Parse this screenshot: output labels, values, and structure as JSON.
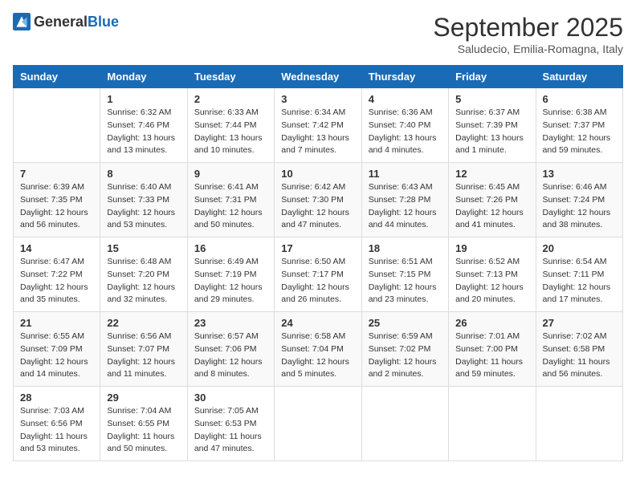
{
  "header": {
    "logo_general": "General",
    "logo_blue": "Blue",
    "month_title": "September 2025",
    "location": "Saludecio, Emilia-Romagna, Italy"
  },
  "days_of_week": [
    "Sunday",
    "Monday",
    "Tuesday",
    "Wednesday",
    "Thursday",
    "Friday",
    "Saturday"
  ],
  "weeks": [
    [
      {
        "day": "",
        "info": ""
      },
      {
        "day": "1",
        "info": "Sunrise: 6:32 AM\nSunset: 7:46 PM\nDaylight: 13 hours\nand 13 minutes."
      },
      {
        "day": "2",
        "info": "Sunrise: 6:33 AM\nSunset: 7:44 PM\nDaylight: 13 hours\nand 10 minutes."
      },
      {
        "day": "3",
        "info": "Sunrise: 6:34 AM\nSunset: 7:42 PM\nDaylight: 13 hours\nand 7 minutes."
      },
      {
        "day": "4",
        "info": "Sunrise: 6:36 AM\nSunset: 7:40 PM\nDaylight: 13 hours\nand 4 minutes."
      },
      {
        "day": "5",
        "info": "Sunrise: 6:37 AM\nSunset: 7:39 PM\nDaylight: 13 hours\nand 1 minute."
      },
      {
        "day": "6",
        "info": "Sunrise: 6:38 AM\nSunset: 7:37 PM\nDaylight: 12 hours\nand 59 minutes."
      }
    ],
    [
      {
        "day": "7",
        "info": "Sunrise: 6:39 AM\nSunset: 7:35 PM\nDaylight: 12 hours\nand 56 minutes."
      },
      {
        "day": "8",
        "info": "Sunrise: 6:40 AM\nSunset: 7:33 PM\nDaylight: 12 hours\nand 53 minutes."
      },
      {
        "day": "9",
        "info": "Sunrise: 6:41 AM\nSunset: 7:31 PM\nDaylight: 12 hours\nand 50 minutes."
      },
      {
        "day": "10",
        "info": "Sunrise: 6:42 AM\nSunset: 7:30 PM\nDaylight: 12 hours\nand 47 minutes."
      },
      {
        "day": "11",
        "info": "Sunrise: 6:43 AM\nSunset: 7:28 PM\nDaylight: 12 hours\nand 44 minutes."
      },
      {
        "day": "12",
        "info": "Sunrise: 6:45 AM\nSunset: 7:26 PM\nDaylight: 12 hours\nand 41 minutes."
      },
      {
        "day": "13",
        "info": "Sunrise: 6:46 AM\nSunset: 7:24 PM\nDaylight: 12 hours\nand 38 minutes."
      }
    ],
    [
      {
        "day": "14",
        "info": "Sunrise: 6:47 AM\nSunset: 7:22 PM\nDaylight: 12 hours\nand 35 minutes."
      },
      {
        "day": "15",
        "info": "Sunrise: 6:48 AM\nSunset: 7:20 PM\nDaylight: 12 hours\nand 32 minutes."
      },
      {
        "day": "16",
        "info": "Sunrise: 6:49 AM\nSunset: 7:19 PM\nDaylight: 12 hours\nand 29 minutes."
      },
      {
        "day": "17",
        "info": "Sunrise: 6:50 AM\nSunset: 7:17 PM\nDaylight: 12 hours\nand 26 minutes."
      },
      {
        "day": "18",
        "info": "Sunrise: 6:51 AM\nSunset: 7:15 PM\nDaylight: 12 hours\nand 23 minutes."
      },
      {
        "day": "19",
        "info": "Sunrise: 6:52 AM\nSunset: 7:13 PM\nDaylight: 12 hours\nand 20 minutes."
      },
      {
        "day": "20",
        "info": "Sunrise: 6:54 AM\nSunset: 7:11 PM\nDaylight: 12 hours\nand 17 minutes."
      }
    ],
    [
      {
        "day": "21",
        "info": "Sunrise: 6:55 AM\nSunset: 7:09 PM\nDaylight: 12 hours\nand 14 minutes."
      },
      {
        "day": "22",
        "info": "Sunrise: 6:56 AM\nSunset: 7:07 PM\nDaylight: 12 hours\nand 11 minutes."
      },
      {
        "day": "23",
        "info": "Sunrise: 6:57 AM\nSunset: 7:06 PM\nDaylight: 12 hours\nand 8 minutes."
      },
      {
        "day": "24",
        "info": "Sunrise: 6:58 AM\nSunset: 7:04 PM\nDaylight: 12 hours\nand 5 minutes."
      },
      {
        "day": "25",
        "info": "Sunrise: 6:59 AM\nSunset: 7:02 PM\nDaylight: 12 hours\nand 2 minutes."
      },
      {
        "day": "26",
        "info": "Sunrise: 7:01 AM\nSunset: 7:00 PM\nDaylight: 11 hours\nand 59 minutes."
      },
      {
        "day": "27",
        "info": "Sunrise: 7:02 AM\nSunset: 6:58 PM\nDaylight: 11 hours\nand 56 minutes."
      }
    ],
    [
      {
        "day": "28",
        "info": "Sunrise: 7:03 AM\nSunset: 6:56 PM\nDaylight: 11 hours\nand 53 minutes."
      },
      {
        "day": "29",
        "info": "Sunrise: 7:04 AM\nSunset: 6:55 PM\nDaylight: 11 hours\nand 50 minutes."
      },
      {
        "day": "30",
        "info": "Sunrise: 7:05 AM\nSunset: 6:53 PM\nDaylight: 11 hours\nand 47 minutes."
      },
      {
        "day": "",
        "info": ""
      },
      {
        "day": "",
        "info": ""
      },
      {
        "day": "",
        "info": ""
      },
      {
        "day": "",
        "info": ""
      }
    ]
  ]
}
